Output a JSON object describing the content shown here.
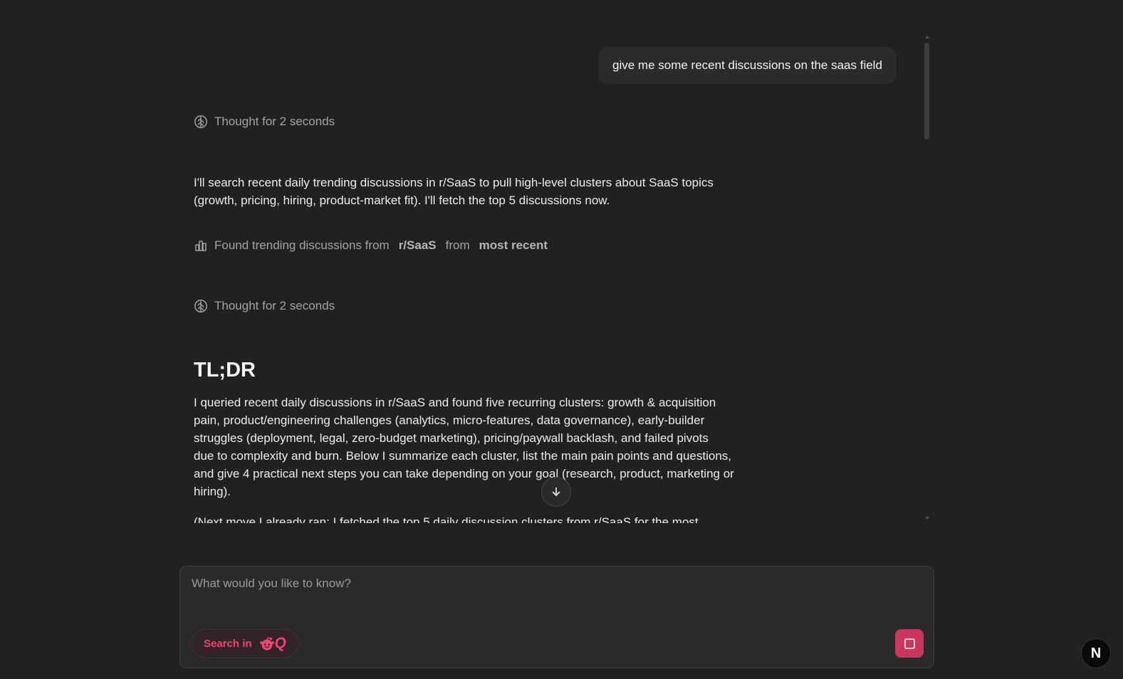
{
  "messages": {
    "user_prompt": "give me some recent discussions on the saas field",
    "thought_1": "Thought for 2 seconds",
    "intro_line_1": "I'll search recent daily trending discussions in r/SaaS to pull high-level clusters about SaaS topics",
    "intro_line_2": "(growth, pricing, hiring, product-market fit). I'll fetch the top 5 discussions now.",
    "tool_status": {
      "prefix": "Found trending discussions from",
      "subreddit": "r/SaaS",
      "from_word": "from",
      "sort": "most recent"
    },
    "thought_2": "Thought for 2 seconds",
    "heading": "TL;DR",
    "tldr_lines": [
      "I queried recent daily discussions in r/SaaS and found five recurring clusters: growth & acquisition",
      "pain, product/engineering challenges (analytics, micro-features, data governance), early-builder",
      "struggles (deployment, legal, zero-budget marketing), pricing/paywall backlash, and failed pivots",
      "due to complexity and burn. Below I summarize each cluster, list the main pain points and questions,",
      "and give 4 practical next steps you can take depending on your goal (research, product, marketing or",
      "hiring)."
    ],
    "cut_off_line": "(Next move I already ran: I fetched the top 5 daily discussion clusters from r/SaaS for the most"
  },
  "composer": {
    "placeholder": "What would you like to know?",
    "value": "",
    "search_label": "Search in",
    "search_logo_letter": "Q"
  },
  "badge": {
    "letter": "N"
  },
  "icons": {
    "thought": "brain-icon",
    "tool": "bar-chart-icon",
    "scroll": "arrow-down-icon",
    "reddit": "reddit-alien-icon",
    "stop": "stop-square-icon"
  },
  "colors": {
    "background": "#212121",
    "accent": "#f0466e",
    "stop_button": "#c9375e"
  }
}
